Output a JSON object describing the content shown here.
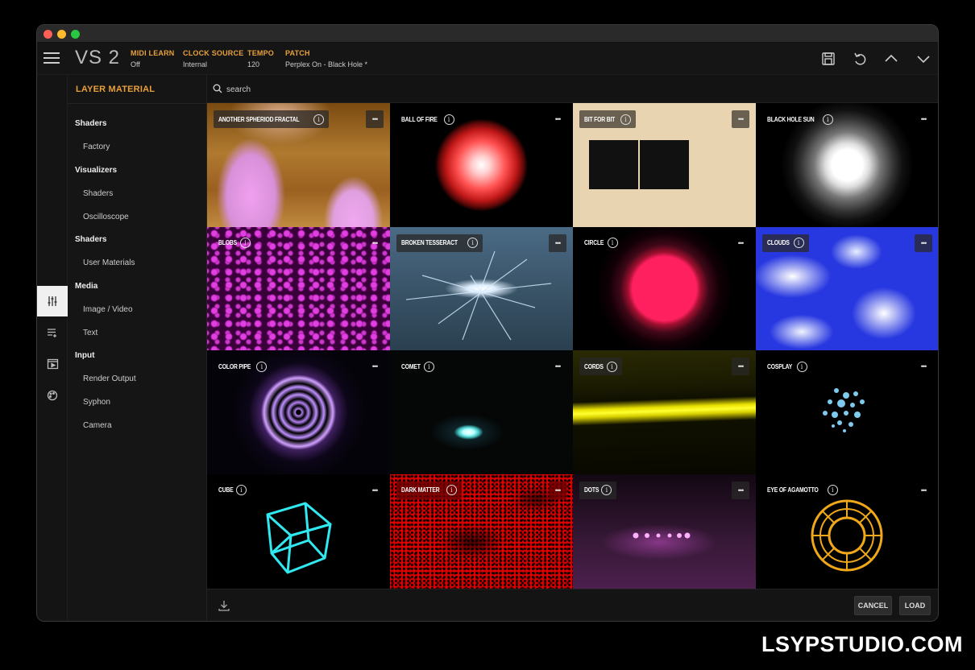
{
  "app": {
    "logo": "VS 2"
  },
  "header": {
    "fields": [
      {
        "label": "MIDI LEARN",
        "value": "Off"
      },
      {
        "label": "CLOCK SOURCE",
        "value": "Internal"
      },
      {
        "label": "TEMPO",
        "value": "120"
      },
      {
        "label": "PATCH",
        "value": "Perplex On - Black Hole *"
      }
    ],
    "icons": [
      "save-icon",
      "undo-icon",
      "chevron-up-icon",
      "chevron-down-icon"
    ]
  },
  "iconbar": {
    "items": [
      "sliders-icon",
      "playlist-icon",
      "media-player-icon",
      "palette-icon"
    ],
    "active": 0
  },
  "sidebar": {
    "title": "LAYER MATERIAL",
    "sections": [
      {
        "heading": "Shaders",
        "items": [
          "Factory"
        ]
      },
      {
        "heading": "Visualizers",
        "items": [
          "Shaders",
          "Oscilloscope"
        ]
      },
      {
        "heading": "Shaders",
        "items": [
          "User Materials"
        ]
      },
      {
        "heading": "Media",
        "items": [
          "Image / Video",
          "Text"
        ]
      },
      {
        "heading": "Input",
        "items": [
          "Render Output",
          "Syphon",
          "Camera"
        ]
      }
    ]
  },
  "search": {
    "placeholder": "search"
  },
  "materials": [
    {
      "name": "ANOTHER SPHERIOD FRACTAL",
      "selected": true
    },
    {
      "name": "BALL OF FIRE"
    },
    {
      "name": "BIT FOR BIT"
    },
    {
      "name": "BLACK HOLE SUN"
    },
    {
      "name": "BLOBS"
    },
    {
      "name": "BROKEN TESSERACT"
    },
    {
      "name": "CIRCLE"
    },
    {
      "name": "CLOUDS"
    },
    {
      "name": "COLOR PIPE"
    },
    {
      "name": "COMET"
    },
    {
      "name": "CORDS"
    },
    {
      "name": "COSPLAY"
    },
    {
      "name": "CUBE"
    },
    {
      "name": "DARK MATTER"
    },
    {
      "name": "DOTS"
    },
    {
      "name": "EYE OF AGAMOTTO"
    }
  ],
  "tile_icons": {
    "info": "i",
    "more": "•••"
  },
  "footer": {
    "cancel_label": "CANCEL",
    "load_label": "LOAD",
    "download_icon": "download-icon"
  },
  "watermark": "LSYPSTUDIO.COM",
  "colors": {
    "accent": "#e8a03a"
  }
}
